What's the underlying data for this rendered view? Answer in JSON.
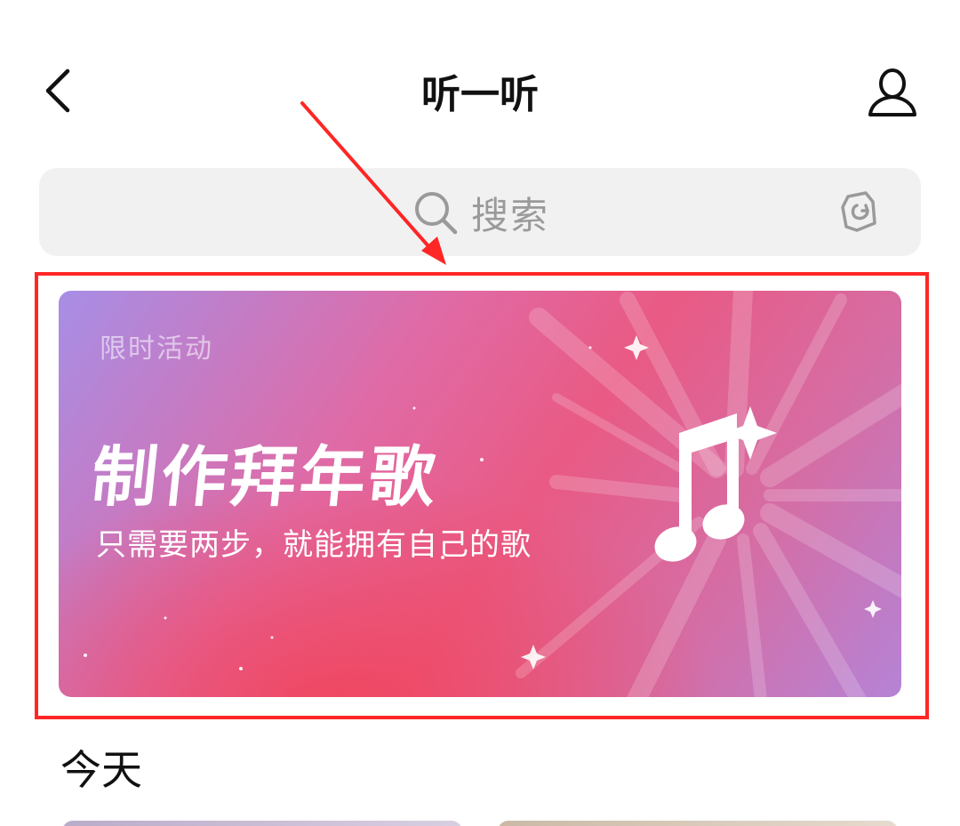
{
  "header": {
    "title": "听一听",
    "back_icon": "chevron-left-icon",
    "profile_icon": "user-icon"
  },
  "search": {
    "placeholder": "搜索",
    "search_icon": "search-icon",
    "scan_icon": "recognize-icon"
  },
  "banner": {
    "tag": "限时活动",
    "title": "制作拜年歌",
    "subtitle": "只需要两步，就能拥有自己的歌",
    "icon": "music-note-icon",
    "colors": {
      "primary": "#e95a84",
      "secondary": "#a78ee6"
    }
  },
  "annotation": {
    "highlight_color": "#ff2626"
  },
  "sections": {
    "today_title": "今天"
  }
}
